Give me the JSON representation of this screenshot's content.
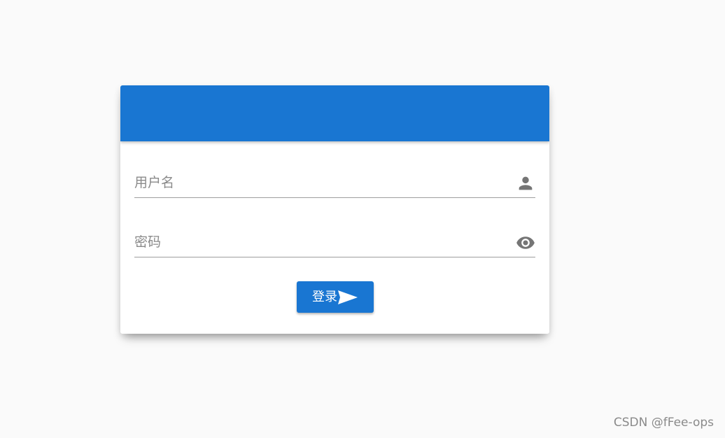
{
  "login": {
    "username": {
      "placeholder": "用户名",
      "value": "",
      "icon": "person-icon"
    },
    "password": {
      "placeholder": "密码",
      "value": "",
      "icon": "eye-icon"
    },
    "submit": {
      "label": "登录",
      "icon": "send-icon"
    }
  },
  "theme": {
    "primary": "#1976d2",
    "background": "#fafafa",
    "icon_color": "#757575"
  },
  "watermark": "CSDN @fFee-ops"
}
